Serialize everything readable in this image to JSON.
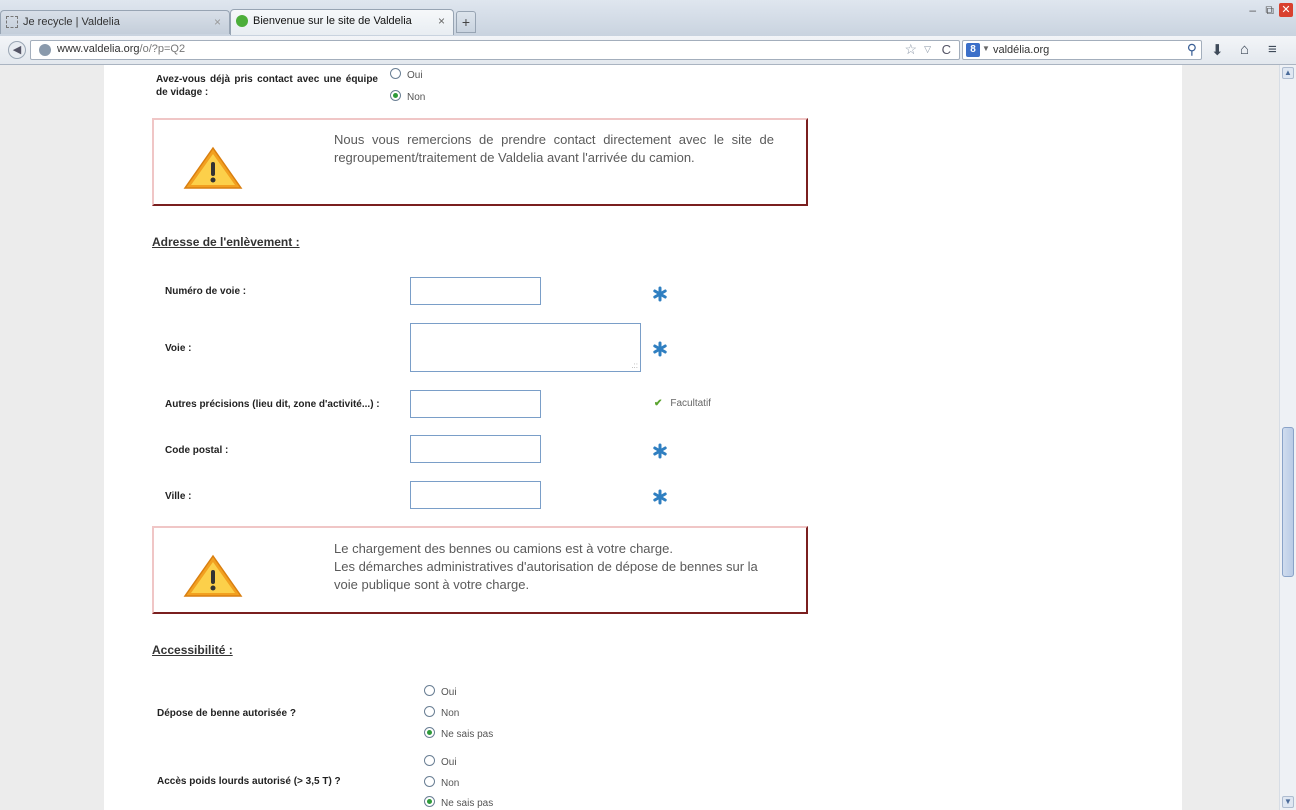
{
  "browser": {
    "tabs": [
      {
        "title": "Je recycle | Valdelia",
        "active": false
      },
      {
        "title": "Bienvenue sur le site de Valdelia",
        "active": true
      }
    ],
    "new_tab": "+",
    "window_controls": {
      "minimize": "–",
      "restore": "⧉",
      "close": "✕"
    },
    "url_host": "www.valdelia.org",
    "url_path": "/o/?p=Q2",
    "search_text": "valdélia.org",
    "search_engine": "8"
  },
  "form": {
    "contact_question": "Avez-vous déjà pris contact avec une équipe de vidage :",
    "contact_options": [
      {
        "label": "Oui",
        "checked": false
      },
      {
        "label": "Non",
        "checked": true
      }
    ],
    "alert1": "Nous vous remercions de prendre contact directement avec le site de regroupement/traitement de Valdelia avant l'arrivée du camion.",
    "address_heading": "Adresse de l'enlèvement :",
    "fields": {
      "numero": {
        "label": "Numéro de voie :",
        "value": ""
      },
      "voie": {
        "label": "Voie :",
        "value": ""
      },
      "autres": {
        "label": "Autres précisions (lieu dit, zone d'activité...) :",
        "value": "",
        "hint": "Facultatif"
      },
      "code_postal": {
        "label": "Code postal :",
        "value": ""
      },
      "ville": {
        "label": "Ville :",
        "value": ""
      }
    },
    "alert2_lines": [
      "Le chargement des bennes ou camions est à votre charge.",
      "Les démarches administratives d'autorisation de dépose de bennes sur la voie publique sont à votre charge."
    ],
    "accessibility_heading": "Accessibilité :",
    "benne_question": "Dépose de benne autorisée ?",
    "benne_options": [
      {
        "label": "Oui",
        "checked": false
      },
      {
        "label": "Non",
        "checked": false
      },
      {
        "label": "Ne sais pas",
        "checked": true
      }
    ],
    "poids_question": "Accès poids lourds autorisé (> 3,5 T) ?",
    "poids_options": [
      {
        "label": "Oui",
        "checked": false
      },
      {
        "label": "Non",
        "checked": false
      },
      {
        "label": "Ne sais pas",
        "checked": true
      }
    ]
  },
  "colors": {
    "accent_border": "#7a1f1f",
    "light_border": "#f0c6c6",
    "radio_checked": "#2e9a3a",
    "required_star": "#2f7fc1"
  }
}
